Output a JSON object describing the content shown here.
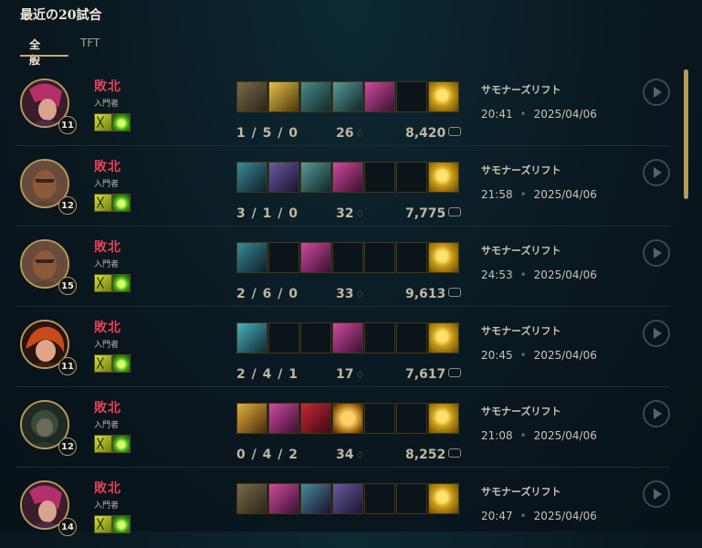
{
  "header": {
    "title": "最近の20試合"
  },
  "tabs": [
    {
      "label": "全般"
    },
    {
      "label": "TFT"
    }
  ],
  "matches": [
    {
      "result": "敗北",
      "rank": "入門者",
      "level": "11",
      "kda": "1 / 5 / 0",
      "cs": "26",
      "gold": "8,420",
      "mode": "サモナーズリフト",
      "time": "20:41",
      "date": "2025/04/06"
    },
    {
      "result": "敗北",
      "rank": "入門者",
      "level": "12",
      "kda": "3 / 1 / 0",
      "cs": "32",
      "gold": "7,775",
      "mode": "サモナーズリフト",
      "time": "21:58",
      "date": "2025/04/06"
    },
    {
      "result": "敗北",
      "rank": "入門者",
      "level": "15",
      "kda": "2 / 6 / 0",
      "cs": "33",
      "gold": "9,613",
      "mode": "サモナーズリフト",
      "time": "24:53",
      "date": "2025/04/06"
    },
    {
      "result": "敗北",
      "rank": "入門者",
      "level": "11",
      "kda": "2 / 4 / 1",
      "cs": "17",
      "gold": "7,617",
      "mode": "サモナーズリフト",
      "time": "20:45",
      "date": "2025/04/06"
    },
    {
      "result": "敗北",
      "rank": "入門者",
      "level": "12",
      "kda": "0 / 4 / 2",
      "cs": "34",
      "gold": "8,252",
      "mode": "サモナーズリフト",
      "time": "21:08",
      "date": "2025/04/06"
    },
    {
      "result": "敗北",
      "rank": "入門者",
      "level": "14",
      "kda": "",
      "cs": "",
      "gold": "",
      "mode": "サモナーズリフト",
      "time": "20:47",
      "date": "2025/04/06"
    }
  ],
  "colors": {
    "defeat": "#e84057",
    "accent_gold": "#c8aa6e",
    "background": "#0a1820"
  }
}
